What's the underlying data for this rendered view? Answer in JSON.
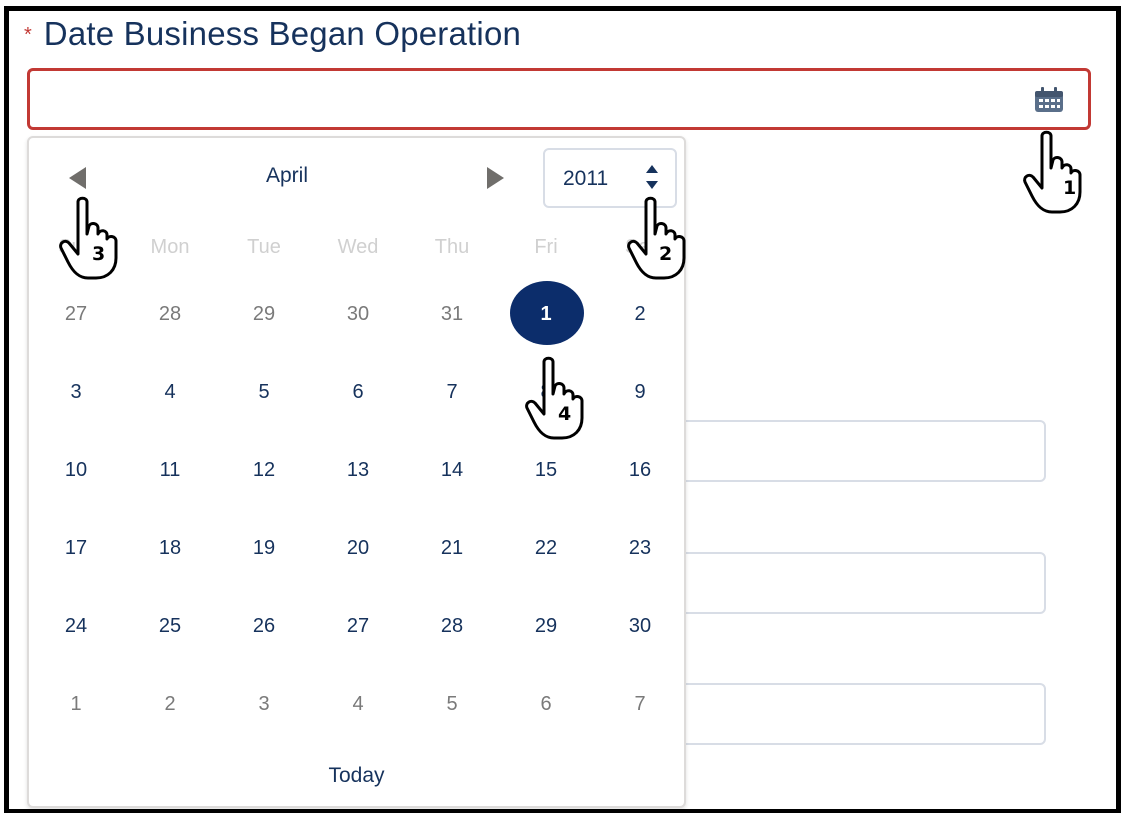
{
  "field": {
    "required_marker": "*",
    "label": "Date Business Began Operation",
    "value": ""
  },
  "picker": {
    "month": "April",
    "year": "2011",
    "weekdays": [
      "Sun",
      "Mon",
      "Tue",
      "Wed",
      "Thu",
      "Fri",
      "Sat"
    ],
    "weeks": [
      [
        "27",
        "28",
        "29",
        "30",
        "31",
        "1",
        "2"
      ],
      [
        "3",
        "4",
        "5",
        "6",
        "7",
        "8",
        "9"
      ],
      [
        "10",
        "11",
        "12",
        "13",
        "14",
        "15",
        "16"
      ],
      [
        "17",
        "18",
        "19",
        "20",
        "21",
        "22",
        "23"
      ],
      [
        "24",
        "25",
        "26",
        "27",
        "28",
        "29",
        "30"
      ],
      [
        "1",
        "2",
        "3",
        "4",
        "5",
        "6",
        "7"
      ]
    ],
    "selected_day": "1",
    "today_label": "Today"
  },
  "annotations": {
    "step1": "1",
    "step2": "2",
    "step3": "3",
    "step4": "4"
  },
  "colors": {
    "brand_text": "#16325c",
    "error_border": "#c23934",
    "selected_fill": "#0c2d6b"
  },
  "icons": {
    "field": "calendar-icon",
    "prev": "caret-left-icon",
    "next": "caret-right-icon",
    "year_spinner": "up-down-spinner-icon",
    "annotation": "hand-pointer-icon"
  }
}
